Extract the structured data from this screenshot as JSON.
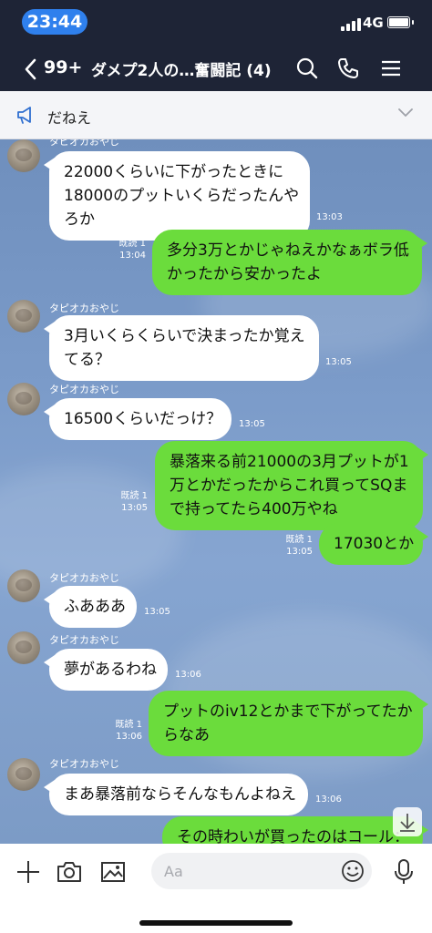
{
  "status": {
    "time": "23:44",
    "network": "4G"
  },
  "header": {
    "back_count": "99+",
    "title": "ダメプ2人の…奮闘記 (4)"
  },
  "announcement": {
    "text": "だねえ"
  },
  "messages": [
    {
      "side": "in",
      "sender": "タピオカおやじ",
      "lines": [
        "22000くらいに下がったときに",
        "18000のプットいくらだったんや",
        "ろか"
      ],
      "time": "13:03"
    },
    {
      "side": "out",
      "read": "既読 1",
      "lines": [
        "多分3万とかじゃねえかなぁボラ低",
        "かったから安かったよ"
      ],
      "time": "13:04"
    },
    {
      "side": "in",
      "sender": "タピオカおやじ",
      "lines": [
        "3月いくらくらいで決まったか覚え",
        "てる？"
      ],
      "time": "13:05"
    },
    {
      "side": "in",
      "sender": "タピオカおやじ",
      "lines": [
        "16500くらいだっけ？"
      ],
      "time": "13:05"
    },
    {
      "side": "out",
      "read": "既読 1",
      "lines": [
        "暴落来る前21000の3月プットが1",
        "万とかだったからこれ買ってSQま",
        "で持ってたら400万やね"
      ],
      "time": "13:05"
    },
    {
      "side": "out",
      "read": "既読 1",
      "lines": [
        "17030とか"
      ],
      "time": "13:05"
    },
    {
      "side": "in",
      "sender": "タピオカおやじ",
      "lines": [
        "ふあああ"
      ],
      "time": "13:05"
    },
    {
      "side": "in",
      "sender": "タピオカおやじ",
      "lines": [
        "夢があるわね"
      ],
      "time": "13:06"
    },
    {
      "side": "out",
      "read": "既読 1",
      "lines": [
        "プットのiv12とかまで下がってたか",
        "らなあ"
      ],
      "time": "13:06"
    },
    {
      "side": "in",
      "sender": "タピオカおやじ",
      "lines": [
        "まあ暴落前ならそんなもんよねえ"
      ],
      "time": "13:06"
    },
    {
      "side": "out",
      "lines": [
        "その時わいが買ったのはコール："
      ]
    }
  ],
  "input": {
    "placeholder": "Aa"
  },
  "icons": {
    "back": "chevron-left-icon",
    "search": "search-icon",
    "call": "phone-icon",
    "menu": "menu-icon",
    "announce": "megaphone-icon",
    "expand": "chevron-down-icon",
    "scroll": "arrow-down-icon",
    "add": "plus-icon",
    "camera": "camera-icon",
    "image": "image-icon",
    "emoji": "emoji-icon",
    "mic": "microphone-icon"
  },
  "colors": {
    "header_bg": "#1e2436",
    "time_pill": "#2f80ed",
    "outgoing": "#6bdc3c",
    "incoming": "#ffffff",
    "chat_bg": "#7b9bc9"
  }
}
